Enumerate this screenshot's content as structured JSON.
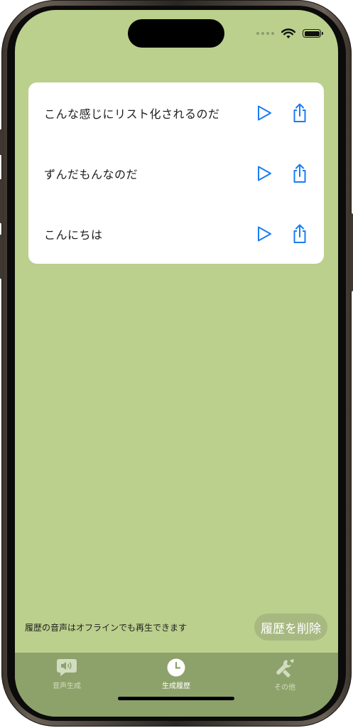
{
  "history": {
    "items": [
      {
        "text": "こんな感じにリスト化されるのだ"
      },
      {
        "text": "ずんだもんなのだ"
      },
      {
        "text": "こんにちは"
      }
    ]
  },
  "footer": {
    "note": "履歴の音声はオフラインでも再生できます",
    "delete_label": "履歴を削除"
  },
  "tabbar": {
    "tabs": [
      {
        "label": "音声生成",
        "icon": "speech-bubble-speaker-icon",
        "active": false
      },
      {
        "label": "生成履歴",
        "icon": "clock-icon",
        "active": true
      },
      {
        "label": "その他",
        "icon": "wrench-tools-icon",
        "active": false
      }
    ]
  },
  "colors": {
    "background": "#bbd08c",
    "tabbar": "#8da26a",
    "accent": "#1a7cf5",
    "card": "#ffffff"
  }
}
